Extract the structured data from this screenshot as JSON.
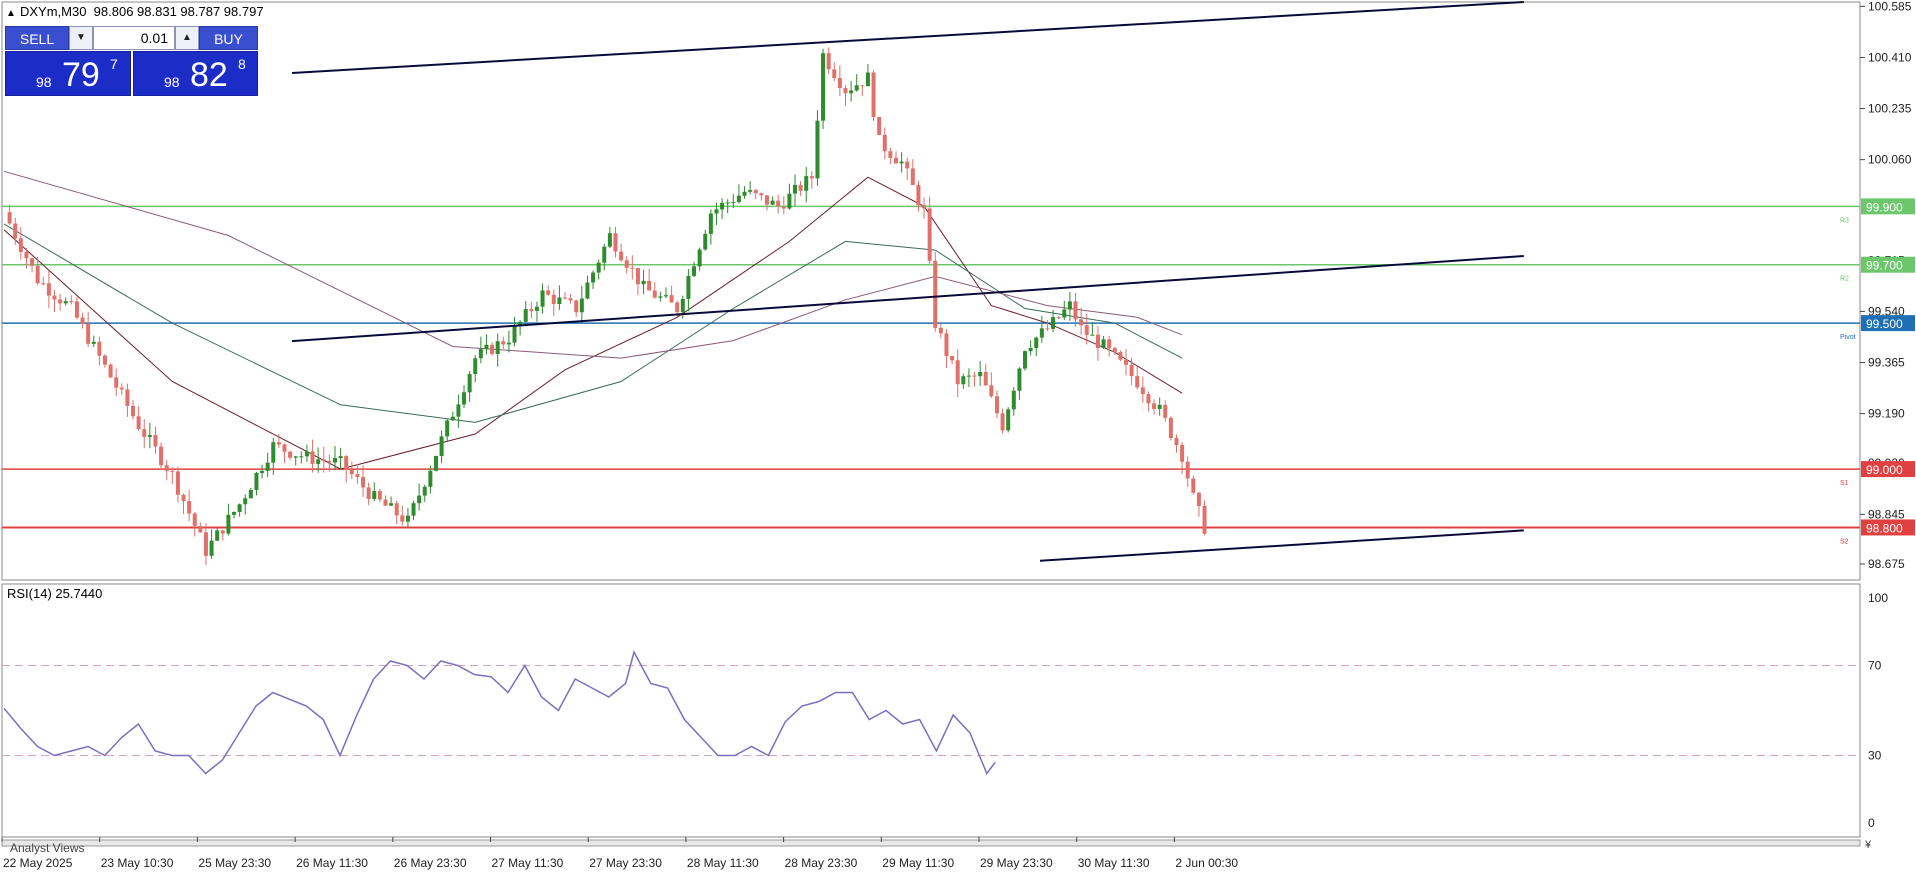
{
  "header": {
    "symbol_line": "DXYm,M30  98.806 98.831 98.787 98.797",
    "rsi_label": "RSI(14) 25.7440",
    "bottom_tab": "Analyst Views"
  },
  "trade_panel": {
    "sell_label": "SELL",
    "buy_label": "BUY",
    "lot_value": "0.01",
    "sell_price": {
      "small": "98",
      "big": "79",
      "sup": "7"
    },
    "buy_price": {
      "small": "98",
      "big": "82",
      "sup": "8"
    }
  },
  "colors": {
    "bull_candle": "#2e8b2e",
    "bear_candle": "#e0706a",
    "trendline": "#0a0a3a",
    "resistance": "#6cc66c",
    "pivot": "#1f6fb5",
    "support": "#e04040",
    "rsi_line": "#7a6ec0",
    "panel_blue": "#1c2cc6"
  },
  "chart_data": [
    {
      "type": "candlestick",
      "symbol": "DXYm",
      "timeframe": "M30",
      "ohlc_last": {
        "open": 98.806,
        "high": 98.831,
        "low": 98.787,
        "close": 98.797
      },
      "ylim": [
        98.62,
        100.6
      ],
      "y_ticks": [
        98.675,
        98.845,
        99.19,
        99.365,
        99.54,
        100.06,
        100.235,
        100.41,
        100.585
      ],
      "y_ticks_partial": [
        {
          "label": "99.715",
          "value": 99.715
        },
        {
          "label": "99.020",
          "value": 99.02
        }
      ],
      "x_ticks": [
        "22 May 2025",
        "23 May 10:30",
        "25 May 23:30",
        "26 May 11:30",
        "26 May 23:30",
        "27 May 11:30",
        "27 May 23:30",
        "28 May 11:30",
        "28 May 23:30",
        "29 May 11:30",
        "29 May 23:30",
        "30 May 11:30",
        "2 Jun 00:30"
      ],
      "levels": [
        {
          "name": "R3",
          "value": 99.9,
          "label": "99.900",
          "color": "#6cc66c"
        },
        {
          "name": "R2",
          "value": 99.7,
          "label": "99.700",
          "color": "#6cc66c"
        },
        {
          "name": "Pivot",
          "value": 99.5,
          "label": "99.500",
          "color": "#1f6fb5"
        },
        {
          "name": "S1",
          "value": 99.0,
          "label": "99.000",
          "color": "#e04040"
        },
        {
          "name": "S2",
          "value": 98.8,
          "label": "98.800",
          "color": "#e04040"
        }
      ],
      "trendlines": [
        {
          "from": {
            "bar": 0,
            "price": 100.3
          },
          "to": {
            "bar": 204,
            "price": 100.6
          }
        },
        {
          "from": {
            "bar": 0,
            "price": 99.37
          },
          "to": {
            "bar": 204,
            "price": 99.73
          }
        },
        {
          "from": {
            "bar": 98,
            "price": 98.62
          },
          "to": {
            "bar": 204,
            "price": 98.79
          }
        }
      ],
      "close_path": [
        [
          0,
          99.88
        ],
        [
          6,
          99.65
        ],
        [
          12,
          99.55
        ],
        [
          18,
          99.35
        ],
        [
          24,
          99.15
        ],
        [
          30,
          98.98
        ],
        [
          36,
          98.72
        ],
        [
          42,
          98.88
        ],
        [
          48,
          99.08
        ],
        [
          54,
          99.04
        ],
        [
          60,
          99.02
        ],
        [
          66,
          98.9
        ],
        [
          72,
          98.82
        ],
        [
          78,
          99.1
        ],
        [
          84,
          99.38
        ],
        [
          90,
          99.45
        ],
        [
          96,
          99.6
        ],
        [
          102,
          99.55
        ],
        [
          108,
          99.8
        ],
        [
          114,
          99.62
        ],
        [
          120,
          99.55
        ],
        [
          126,
          99.88
        ],
        [
          132,
          99.95
        ],
        [
          138,
          99.9
        ],
        [
          144,
          100.0
        ],
        [
          146,
          100.42
        ],
        [
          150,
          100.3
        ],
        [
          154,
          100.34
        ],
        [
          156,
          100.12
        ],
        [
          160,
          100.05
        ],
        [
          164,
          99.88
        ],
        [
          166,
          99.5
        ],
        [
          170,
          99.3
        ],
        [
          174,
          99.32
        ],
        [
          178,
          99.15
        ],
        [
          182,
          99.42
        ],
        [
          186,
          99.48
        ],
        [
          190,
          99.56
        ],
        [
          192,
          99.48
        ],
        [
          196,
          99.42
        ],
        [
          198,
          99.38
        ],
        [
          202,
          99.3
        ],
        [
          206,
          99.2
        ],
        [
          210,
          99.05
        ],
        [
          212,
          98.9
        ],
        [
          214,
          98.8
        ]
      ],
      "moving_averages": [
        {
          "points": [
            [
              0,
              99.82
            ],
            [
              30,
              99.3
            ],
            [
              60,
              99.0
            ],
            [
              84,
              99.12
            ],
            [
              100,
              99.34
            ],
            [
              120,
              99.52
            ],
            [
              140,
              99.78
            ],
            [
              154,
              100.0
            ],
            [
              164,
              99.9
            ],
            [
              176,
              99.56
            ],
            [
              186,
              99.5
            ],
            [
              198,
              99.4
            ],
            [
              210,
              99.26
            ]
          ]
        },
        {
          "points": [
            [
              0,
              99.84
            ],
            [
              30,
              99.5
            ],
            [
              60,
              99.22
            ],
            [
              84,
              99.16
            ],
            [
              110,
              99.3
            ],
            [
              130,
              99.55
            ],
            [
              150,
              99.78
            ],
            [
              166,
              99.75
            ],
            [
              182,
              99.55
            ],
            [
              198,
              99.5
            ],
            [
              210,
              99.38
            ]
          ]
        },
        {
          "points": [
            [
              0,
              100.02
            ],
            [
              40,
              99.8
            ],
            [
              80,
              99.42
            ],
            [
              110,
              99.38
            ],
            [
              130,
              99.44
            ],
            [
              150,
              99.58
            ],
            [
              166,
              99.66
            ],
            [
              186,
              99.56
            ],
            [
              202,
              99.52
            ],
            [
              210,
              99.46
            ]
          ]
        }
      ]
    },
    {
      "type": "line",
      "title": "RSI(14) 25.7440",
      "ylim": [
        0,
        100
      ],
      "y_ticks": [
        0,
        30,
        70,
        100
      ],
      "reference_lines": [
        30,
        70
      ],
      "series": [
        {
          "values": [
            [
              0,
              51
            ],
            [
              4,
              42
            ],
            [
              8,
              34
            ],
            [
              12,
              30
            ],
            [
              16,
              32
            ],
            [
              20,
              34
            ],
            [
              24,
              30
            ],
            [
              28,
              38
            ],
            [
              32,
              44
            ],
            [
              36,
              32
            ],
            [
              40,
              30
            ],
            [
              44,
              30
            ],
            [
              48,
              22
            ],
            [
              52,
              28
            ],
            [
              56,
              40
            ],
            [
              60,
              52
            ],
            [
              64,
              58
            ],
            [
              68,
              55
            ],
            [
              72,
              52
            ],
            [
              76,
              46
            ],
            [
              80,
              30
            ],
            [
              84,
              48
            ],
            [
              88,
              64
            ],
            [
              92,
              72
            ],
            [
              96,
              70
            ],
            [
              100,
              64
            ],
            [
              104,
              72
            ],
            [
              108,
              70
            ],
            [
              112,
              66
            ],
            [
              116,
              65
            ],
            [
              120,
              58
            ],
            [
              124,
              70
            ],
            [
              128,
              56
            ],
            [
              132,
              50
            ],
            [
              136,
              64
            ],
            [
              140,
              60
            ],
            [
              144,
              56
            ],
            [
              148,
              62
            ],
            [
              150,
              76
            ],
            [
              154,
              62
            ],
            [
              158,
              60
            ],
            [
              162,
              46
            ],
            [
              166,
              38
            ],
            [
              170,
              30
            ],
            [
              174,
              30
            ],
            [
              178,
              34
            ],
            [
              182,
              30
            ],
            [
              186,
              45
            ],
            [
              190,
              52
            ],
            [
              194,
              54
            ],
            [
              198,
              58
            ],
            [
              202,
              58
            ],
            [
              206,
              46
            ],
            [
              210,
              50
            ],
            [
              214,
              44
            ],
            [
              218,
              46
            ],
            [
              222,
              32
            ],
            [
              226,
              48
            ],
            [
              230,
              40
            ],
            [
              234,
              22
            ],
            [
              236,
              27
            ]
          ]
        }
      ]
    }
  ]
}
